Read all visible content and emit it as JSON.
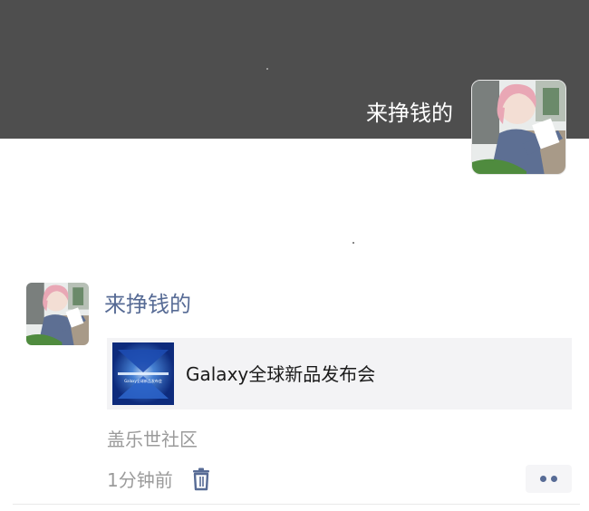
{
  "cover": {
    "username": "来挣钱的"
  },
  "post": {
    "username": "来挣钱的",
    "link_title": "Galaxy全球新品发布会",
    "link_thumb_caption": "Galaxy全球新品发布会",
    "source": "盖乐世社区",
    "time": "1分钟前"
  },
  "icons": {
    "delete": "trash-icon",
    "more": "more-dots-icon"
  },
  "colors": {
    "cover_bg": "#4e4e4e",
    "username_link": "#576b95",
    "card_bg": "#f3f3f5",
    "meta_text": "#9b9b9b"
  }
}
